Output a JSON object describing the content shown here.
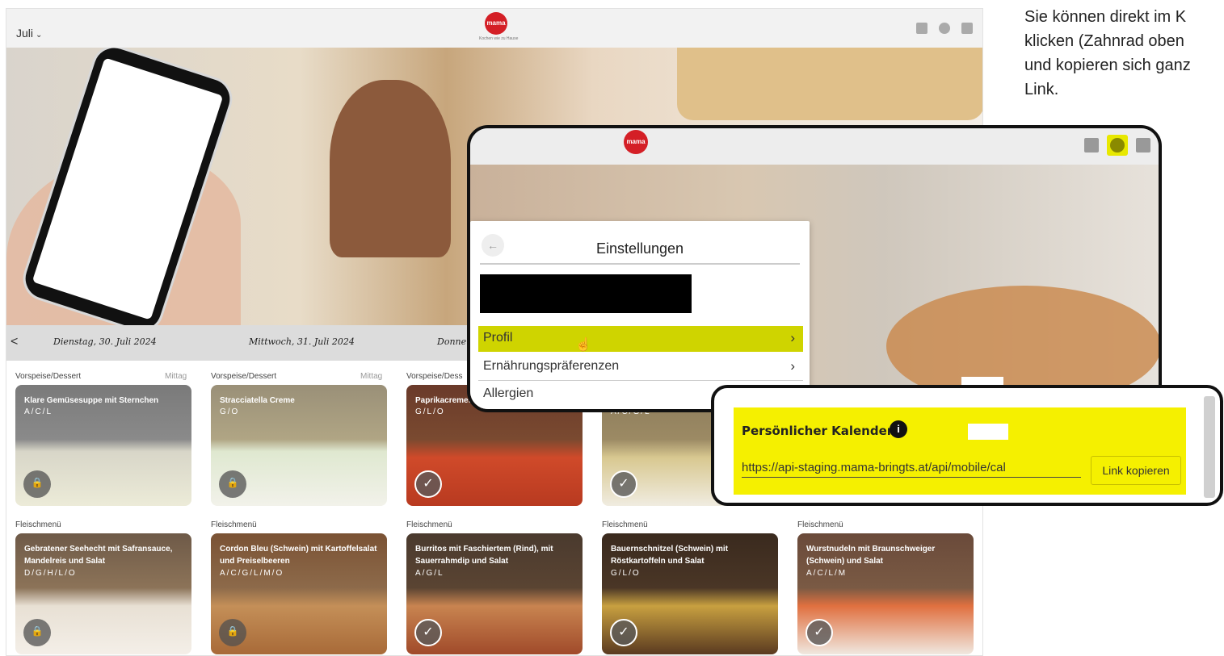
{
  "header": {
    "month": "Juli",
    "logo_text": "mama",
    "logo_tagline": "Kochen wie zu Hause"
  },
  "daybar": {
    "prev_label": "<",
    "days": [
      "Dienstag, 30. Juli 2024",
      "Mittwoch, 31. Juli 2024",
      "Donne"
    ]
  },
  "columns": [
    {
      "starter_category": "Vorspeise/Dessert",
      "starter_time": "Mittag",
      "starter_title": "Klare Gemüsesuppe mit Sternchen",
      "starter_allergens": "A/C/L",
      "starter_status": "locked",
      "main_category": "Fleischmenü",
      "main_title": "Gebratener Seehecht mit Safransauce, Mandelreis und Salat",
      "main_allergens": "D/G/H/L/O",
      "main_status": "locked"
    },
    {
      "starter_category": "Vorspeise/Dessert",
      "starter_time": "Mittag",
      "starter_title": "Stracciatella Creme",
      "starter_allergens": "G/O",
      "starter_status": "locked",
      "main_category": "Fleischmenü",
      "main_title": "Cordon Bleu (Schwein) mit Kartoffelsalat und Preiselbeeren",
      "main_allergens": "A/C/G/L/M/O",
      "main_status": "locked"
    },
    {
      "starter_category": "Vorspeise/Dess",
      "starter_time": "",
      "starter_title": "Paprikacremes",
      "starter_allergens": "G/L/O",
      "starter_status": "checked",
      "main_category": "Fleischmenü",
      "main_title": "Burritos mit Faschiertem (Rind), mit Sauerrahmdip und Salat",
      "main_allergens": "A/G/L",
      "main_status": "checked"
    },
    {
      "starter_category": "",
      "starter_time": "",
      "starter_title": "",
      "starter_allergens": "A/C/G/L",
      "starter_status": "checked",
      "main_category": "Fleischmenü",
      "main_title": "Bauernschnitzel (Schwein) mit Röstkartoffeln und Salat",
      "main_allergens": "G/L/O",
      "main_status": "checked"
    },
    {
      "starter_category": "",
      "starter_time": "",
      "starter_title": "",
      "starter_allergens": "",
      "starter_status": "",
      "main_category": "Fleischmenü",
      "main_title": "Wurstnudeln mit Braunschweiger (Schwein) und Salat",
      "main_allergens": "A/C/L/M",
      "main_status": "checked"
    }
  ],
  "help": {
    "line1": "Sie können direkt im K",
    "line2": "klicken (Zahnrad oben",
    "line3": "und kopieren sich ganz",
    "line4": "Link."
  },
  "settings": {
    "title": "Einstellungen",
    "items": [
      {
        "label": "Profil"
      },
      {
        "label": "Ernährungspräferenzen"
      },
      {
        "label": "Allergien"
      }
    ]
  },
  "calendar": {
    "title": "Persönlicher Kalender",
    "url": "https://api-staging.mama-bringts.at/api/mobile/cal",
    "copy_label": "Link kopieren"
  },
  "colors": {
    "highlight_yellow": "#f5f000",
    "profile_highlight": "#cfd400",
    "brand_red": "#d41f26"
  }
}
